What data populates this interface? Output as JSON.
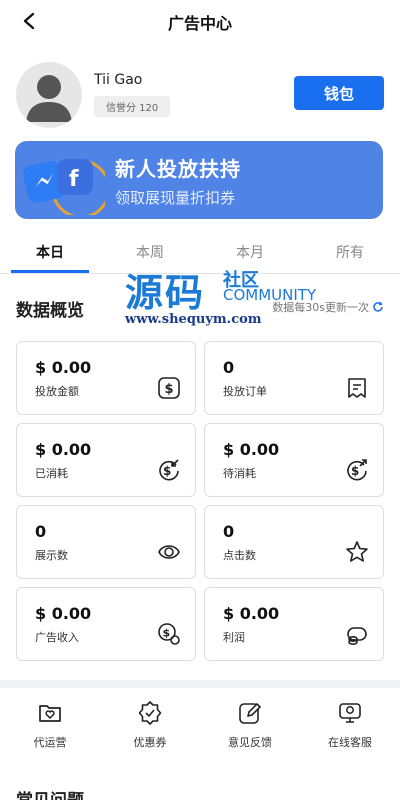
{
  "header": {
    "title": "广告中心"
  },
  "profile": {
    "name": "Tii Gao",
    "credit": "信誉分 120",
    "wallet_label": "钱包"
  },
  "banner": {
    "title": "新人投放扶持",
    "subtitle": "领取展现量折扣券"
  },
  "tabs": [
    {
      "label": "本日",
      "active": true
    },
    {
      "label": "本周",
      "active": false
    },
    {
      "label": "本月",
      "active": false
    },
    {
      "label": "所有",
      "active": false
    }
  ],
  "overview": {
    "title": "数据概览",
    "refresh_note": "数据每30s更新一次"
  },
  "watermark": {
    "big": "源码",
    "cn": "社区",
    "en": "COMMUNITY",
    "url": "www.shequym.com"
  },
  "stats": [
    {
      "value": "$ 0.00",
      "label": "投放金额",
      "icon": "dollar-box-icon"
    },
    {
      "value": "0",
      "label": "投放订单",
      "icon": "receipt-icon"
    },
    {
      "value": "$ 0.00",
      "label": "已消耗",
      "icon": "dollar-in-icon"
    },
    {
      "value": "$ 0.00",
      "label": "待消耗",
      "icon": "dollar-out-icon"
    },
    {
      "value": "0",
      "label": "展示数",
      "icon": "eye-icon"
    },
    {
      "value": "0",
      "label": "点击数",
      "icon": "star-click-icon"
    },
    {
      "value": "$ 0.00",
      "label": "广告收入",
      "icon": "coin-icon"
    },
    {
      "value": "$ 0.00",
      "label": "利润",
      "icon": "money-bag-icon"
    }
  ],
  "quick_actions": [
    {
      "label": "代运营",
      "icon": "heart-folder-icon"
    },
    {
      "label": "优惠券",
      "icon": "badge-check-icon"
    },
    {
      "label": "意见反馈",
      "icon": "edit-icon"
    },
    {
      "label": "在线客服",
      "icon": "chat-monitor-icon"
    }
  ],
  "faq": {
    "title": "常见问题"
  }
}
